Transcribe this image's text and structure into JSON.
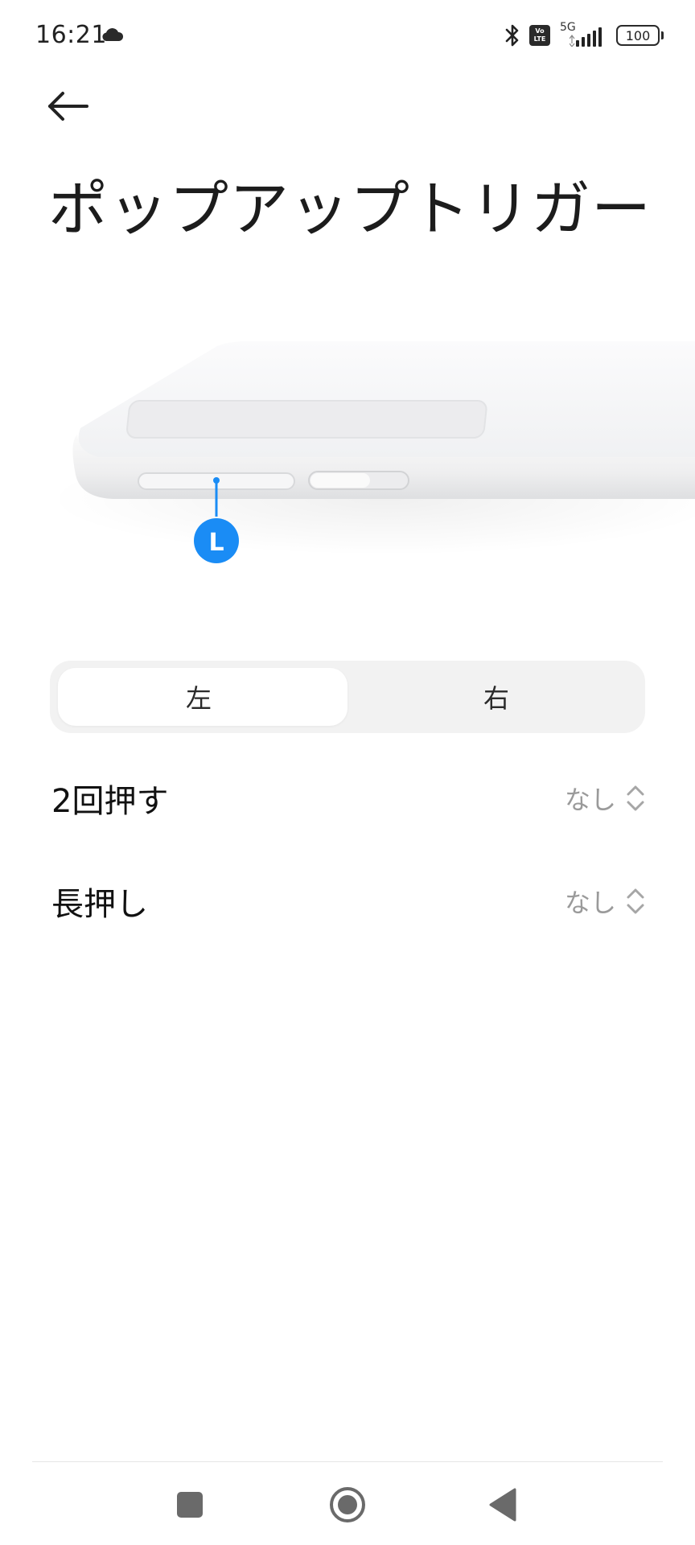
{
  "status_bar": {
    "time": "16:21",
    "network": "5G",
    "volte_top": "Vo",
    "volte_bottom": "LTE",
    "battery": "100"
  },
  "header": {
    "title": "ポップアップトリガー"
  },
  "illustration": {
    "marker_label": "L",
    "accent_color": "#1a8cf5"
  },
  "segmented": {
    "tabs": [
      {
        "label": "左",
        "selected": true
      },
      {
        "label": "右",
        "selected": false
      }
    ]
  },
  "settings": {
    "items": [
      {
        "label": "2回押す",
        "value": "なし"
      },
      {
        "label": "長押し",
        "value": "なし"
      }
    ]
  },
  "icons": {
    "status": [
      "cloud-icon",
      "bluetooth-icon",
      "volte-icon",
      "signal-icon",
      "battery-icon"
    ],
    "nav": [
      "recents-icon",
      "home-icon",
      "back-nav-icon"
    ]
  }
}
